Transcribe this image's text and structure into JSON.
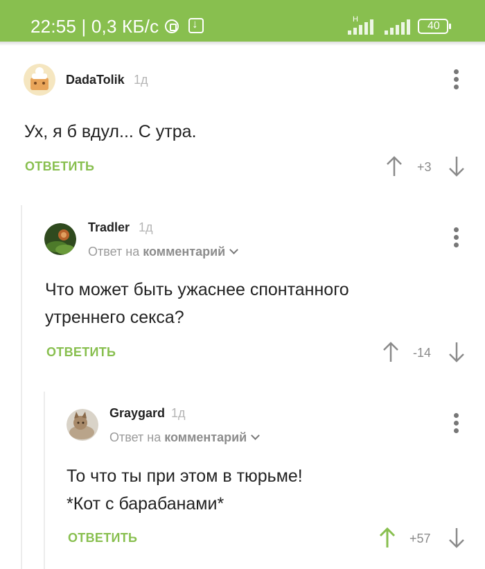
{
  "status_bar": {
    "time_speed": "22:55 | 0,3 КБ/с",
    "network_type": "H",
    "battery": "40",
    "icons": [
      "whatsapp-icon",
      "download-icon",
      "signal-icon",
      "battery-icon"
    ],
    "color": "#88bf4f"
  },
  "comments": [
    {
      "username": "DadaTolik",
      "time": "1д",
      "reply_to": "",
      "text_lines": [
        "Ух, я б вдул... С утра."
      ],
      "reply_label": "ОТВЕТИТЬ",
      "score": "+3",
      "vote": "none"
    },
    {
      "username": "Tradler",
      "time": "1д",
      "reply_to_prefix": "Ответ на",
      "reply_to_target": "комментарий",
      "text_lines": [
        "Что может быть ужаснее спонтанного",
        "утреннего секса?"
      ],
      "reply_label": "ОТВЕТИТЬ",
      "score": "-14",
      "vote": "none"
    },
    {
      "username": "Graygard",
      "time": "1д",
      "reply_to_prefix": "Ответ на",
      "reply_to_target": "комментарий",
      "text_lines": [
        "То что ты при этом в тюрьме!",
        "*Кот с барабанами*"
      ],
      "reply_label": "ОТВЕТИТЬ",
      "score": "+57",
      "vote": "up"
    }
  ],
  "colors": {
    "accent": "#88bf4f",
    "vote_neutral": "#8a8a8a",
    "vote_up_active": "#88bf4f"
  }
}
